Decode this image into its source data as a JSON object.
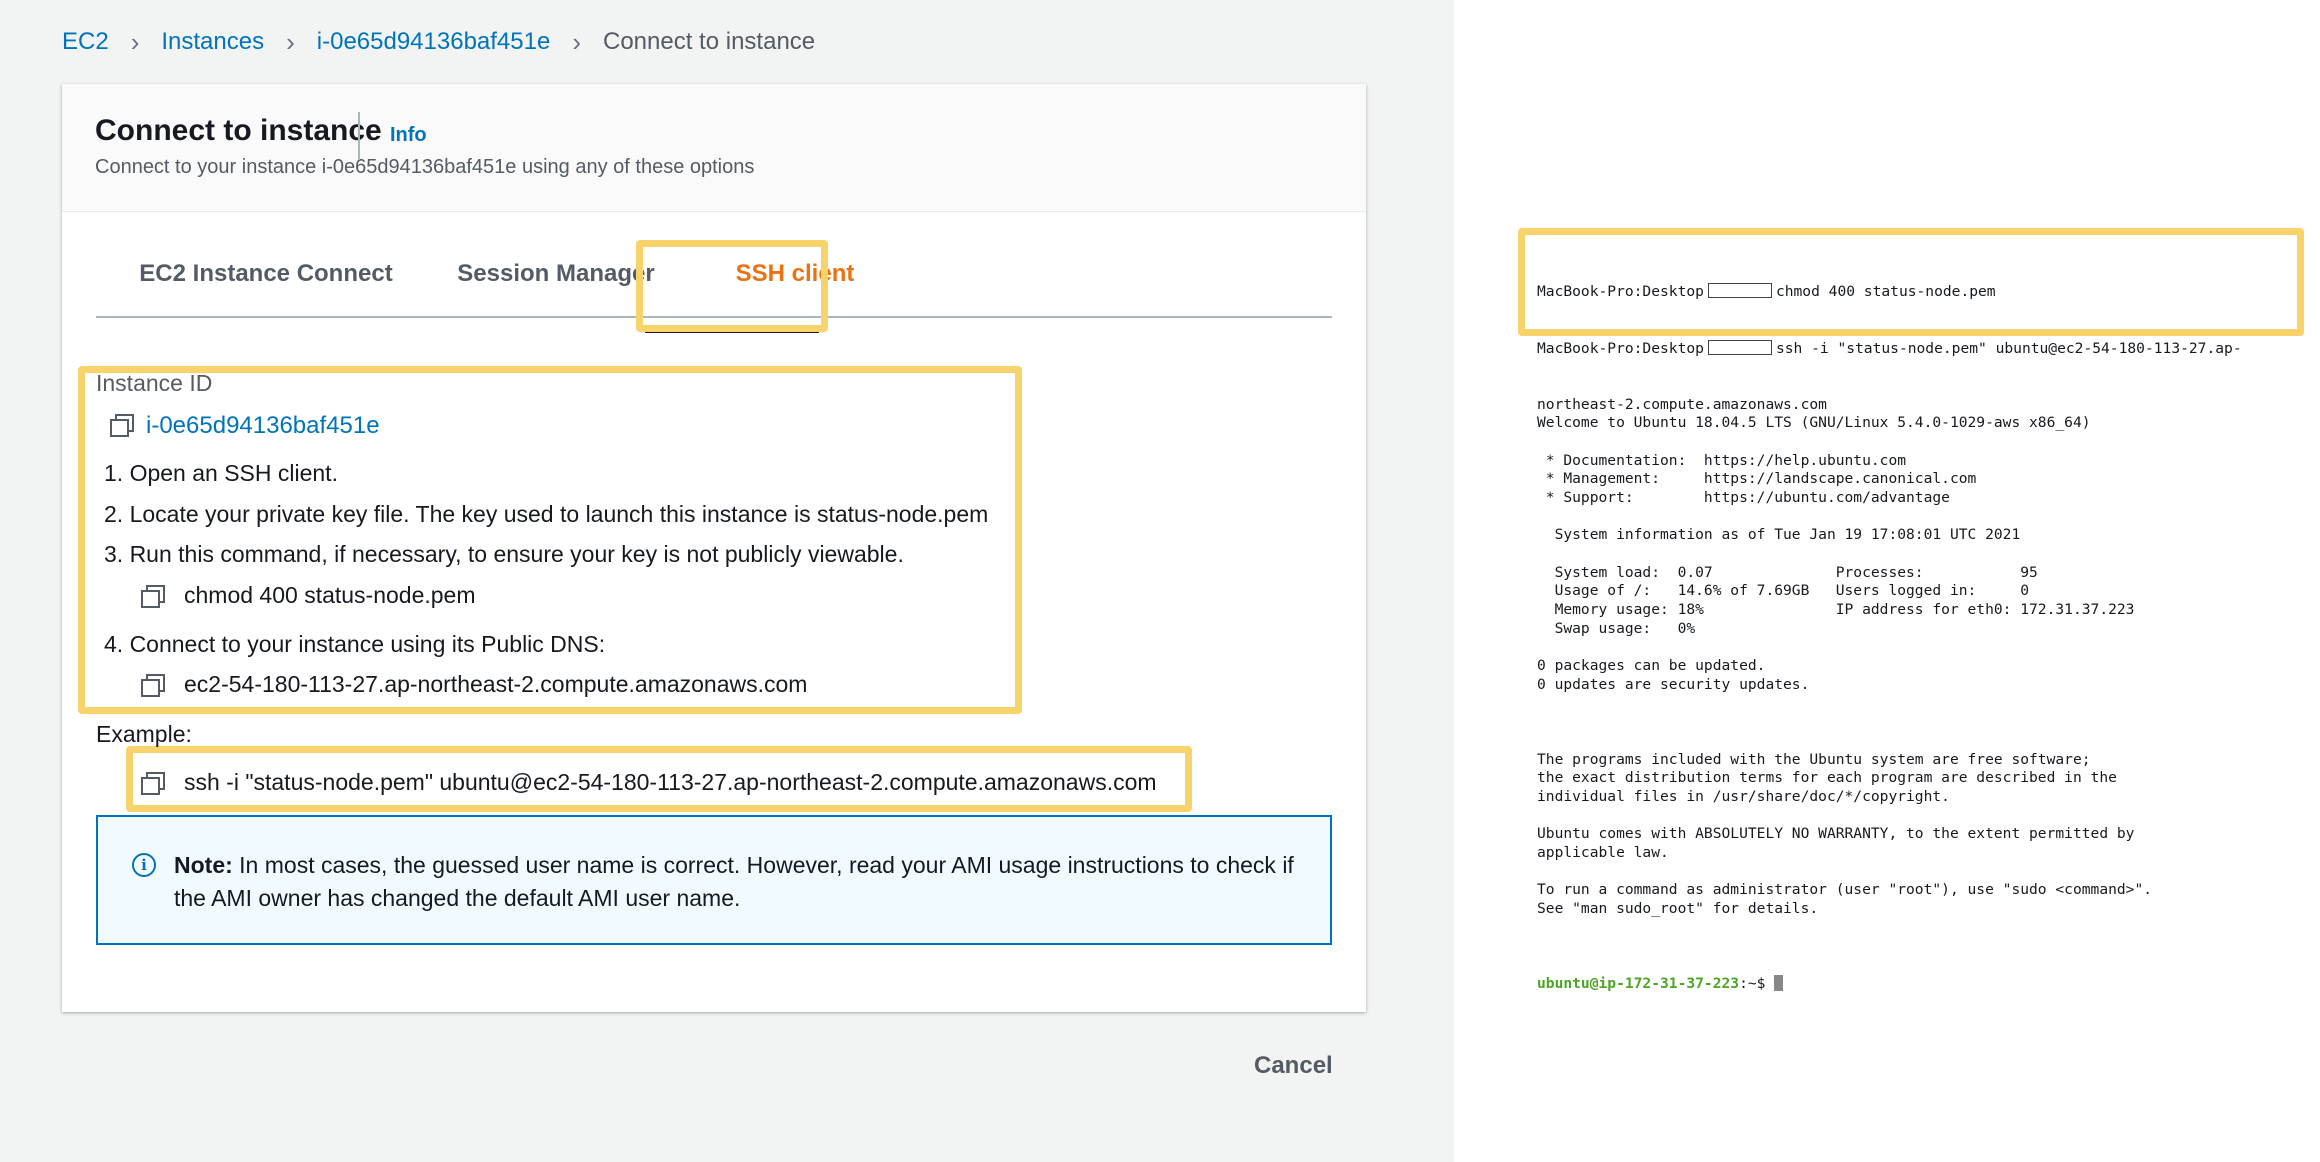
{
  "breadcrumb": {
    "items": [
      "EC2",
      "Instances",
      "i-0e65d94136baf451e"
    ],
    "current": "Connect to instance"
  },
  "header": {
    "title": "Connect to instance",
    "info": "Info",
    "description": "Connect to your instance i-0e65d94136baf451e using any of these options"
  },
  "tabs": [
    {
      "label": "EC2 Instance Connect"
    },
    {
      "label": "Session Manager"
    },
    {
      "label": "SSH client",
      "active": true
    }
  ],
  "content": {
    "instance_id_label": "Instance ID",
    "instance_id": "i-0e65d94136baf451e",
    "steps": [
      "1. Open an SSH client.",
      "2. Locate your private key file. The key used to launch this instance is status-node.pem",
      "3. Run this command, if necessary, to ensure your key is not publicly viewable.",
      "4. Connect to your instance using its Public DNS:"
    ],
    "chmod_cmd": "chmod 400 status-node.pem",
    "public_dns": "ec2-54-180-113-27.ap-northeast-2.compute.amazonaws.com",
    "example_label": "Example:",
    "example_cmd": "ssh -i \"status-node.pem\" ubuntu@ec2-54-180-113-27.ap-northeast-2.compute.amazonaws.com"
  },
  "note": {
    "label": "Note:",
    "text": " In most cases, the guessed user name is correct. However, read your AMI usage instructions to check if the AMI owner has changed the default AMI user name."
  },
  "footer": {
    "cancel": "Cancel"
  },
  "terminal": {
    "prompt_host": "MacBook-Pro:Desktop",
    "cmd1": "chmod 400 status-node.pem",
    "cmd2": "ssh -i \"status-node.pem\" ubuntu@ec2-54-180-113-27.ap-",
    "lines": [
      "northeast-2.compute.amazonaws.com",
      "Welcome to Ubuntu 18.04.5 LTS (GNU/Linux 5.4.0-1029-aws x86_64)",
      "",
      " * Documentation:  https://help.ubuntu.com",
      " * Management:     https://landscape.canonical.com",
      " * Support:        https://ubuntu.com/advantage",
      "",
      "  System information as of Tue Jan 19 17:08:01 UTC 2021",
      "",
      "  System load:  0.07              Processes:           95",
      "  Usage of /:   14.6% of 7.69GB   Users logged in:     0",
      "  Memory usage: 18%               IP address for eth0: 172.31.37.223",
      "  Swap usage:   0%",
      "",
      "0 packages can be updated.",
      "0 updates are security updates.",
      "",
      "",
      "",
      "The programs included with the Ubuntu system are free software;",
      "the exact distribution terms for each program are described in the",
      "individual files in /usr/share/doc/*/copyright.",
      "",
      "Ubuntu comes with ABSOLUTELY NO WARRANTY, to the extent permitted by",
      "applicable law.",
      "",
      "To run a command as administrator (user \"root\"), use \"sudo <command>\".",
      "See \"man sudo_root\" for details.",
      ""
    ],
    "final_prompt_user": "ubuntu@ip-172-31-37-223",
    "final_prompt_suffix": ":~$ "
  },
  "colors": {
    "link": "#0073bb",
    "active_tab": "#ec7211",
    "highlight": "#f8d36b",
    "prompt_green": "#4ca623"
  }
}
